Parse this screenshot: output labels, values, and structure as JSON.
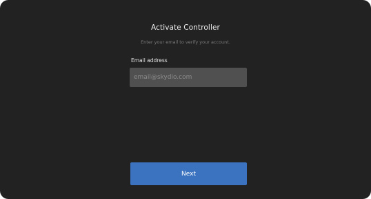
{
  "dialog": {
    "title": "Activate Controller",
    "subtitle": "Enter your email to verify your account."
  },
  "email": {
    "label": "Email address",
    "value": "",
    "placeholder": "email@skydio.com"
  },
  "actions": {
    "next_label": "Next"
  },
  "colors": {
    "background": "#222222",
    "input_background": "#505050",
    "primary_button": "#3b73c0"
  }
}
